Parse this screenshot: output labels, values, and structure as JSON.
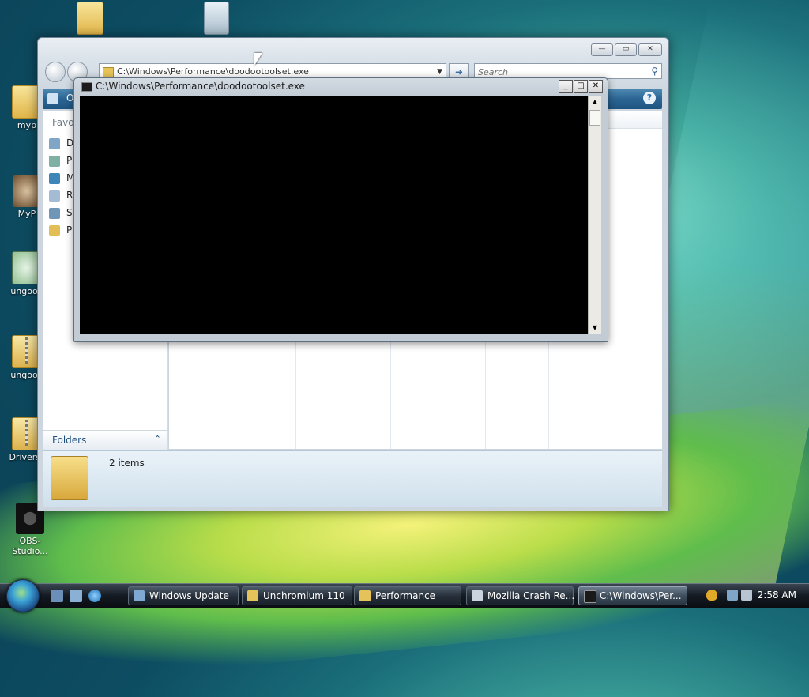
{
  "desktop": {
    "icons": [
      {
        "label": ""
      },
      {
        "label": ""
      },
      {
        "label": "myp"
      },
      {
        "label": "MyP"
      },
      {
        "label": "ungoog"
      },
      {
        "label": "ungoog"
      },
      {
        "label": "Drivers_"
      },
      {
        "label": "OBS-Studio..."
      }
    ]
  },
  "explorer": {
    "address": "C:\\Windows\\Performance\\doodootoolset.exe",
    "search_placeholder": "Search",
    "organize_label": "O",
    "help_label": "?",
    "nav_header": "Favor",
    "nav_items": [
      {
        "label": "D"
      },
      {
        "label": "P"
      },
      {
        "label": "M"
      },
      {
        "label": "R"
      },
      {
        "label": "Se"
      },
      {
        "label": "P"
      }
    ],
    "folders_label": "Folders",
    "folders_chevron": "⌃",
    "status_count": "2 items",
    "window_buttons": {
      "minimize": "—",
      "maximize": "▭",
      "close": "✕"
    }
  },
  "console": {
    "title": "C:\\Windows\\Performance\\doodootoolset.exe",
    "buttons": {
      "minimize": "_",
      "maximize": "□",
      "close": "✕"
    },
    "scroll_up": "▲",
    "scroll_down": "▼"
  },
  "taskbar": {
    "items": [
      {
        "label": "Windows Update",
        "icon": "windows-update-icon",
        "active": false
      },
      {
        "label": "Unchromium 110",
        "icon": "folder-icon",
        "active": false
      },
      {
        "label": "Performance",
        "icon": "folder-icon",
        "active": false
      },
      {
        "label": "Mozilla Crash Re...",
        "icon": "app-window-icon",
        "active": false
      },
      {
        "label": "C:\\Windows\\Per...",
        "icon": "console-icon",
        "active": true
      }
    ],
    "clock": "2:58 AM"
  },
  "colors": {
    "taskbar_bg": "#141a22",
    "command_bar": "#2c6594",
    "console_bg": "#000000"
  }
}
